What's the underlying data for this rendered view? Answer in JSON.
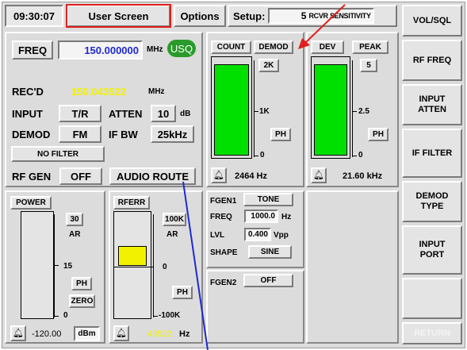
{
  "header": {
    "time": "09:30:07",
    "screen_title": "User Screen",
    "options_label": "Options",
    "setup_label": "Setup:",
    "setup_value": "5",
    "setup_item": "RCVR SENSITIVITY"
  },
  "receiver": {
    "freq_label": "FREQ",
    "freq_value": "150.000000",
    "freq_unit": "MHz",
    "usq_label": "USQ",
    "recd_label": "REC'D",
    "recd_value": "150.043522",
    "recd_unit": "MHz",
    "input_label": "INPUT",
    "input_value": "T/R",
    "atten_label": "ATTEN",
    "atten_value": "10",
    "atten_unit": "dB",
    "demod_label": "DEMOD",
    "demod_value": "FM",
    "ifbw_label": "IF BW",
    "ifbw_value": "25kHz",
    "filter_value": "NO FILTER",
    "rfgen_label": "RF GEN",
    "rfgen_value": "OFF",
    "audio_route_label": "AUDIO ROUTE"
  },
  "count_meter": {
    "count_label": "COUNT",
    "demod_label": "DEMOD",
    "range": "2K",
    "tick_mid": "1K",
    "tick_low": "0",
    "ph_label": "PH",
    "level_fraction": 0.95,
    "readout": "2464 Hz"
  },
  "dev_meter": {
    "dev_label": "DEV",
    "peak_label": "PEAK",
    "range": "5",
    "tick_mid": "2.5",
    "tick_low": "0",
    "ph_label": "PH",
    "level_fraction": 0.95,
    "readout": "21.60 kHz"
  },
  "power_meter": {
    "title": "POWER",
    "range": "30",
    "ar_label": "AR",
    "tick_mid": "15",
    "tick_low": "0",
    "ph_label": "PH",
    "zero_label": "ZERO",
    "readout_value": "-120.00",
    "readout_unit": "dBm"
  },
  "rferr_meter": {
    "title": "RFERR",
    "range": "100K",
    "ar_label": "AR",
    "tick_mid": "0",
    "tick_low": "-100K",
    "ph_label": "PH",
    "readout_value": "43522",
    "readout_unit": "Hz"
  },
  "fgen1": {
    "label": "FGEN1",
    "type": "TONE",
    "freq_label": "FREQ",
    "freq_value": "1000.0",
    "freq_unit": "Hz",
    "lvl_label": "LVL",
    "lvl_value": "0.400",
    "lvl_unit": "Vpp",
    "shape_label": "SHAPE",
    "shape_value": "SINE"
  },
  "fgen2": {
    "label": "FGEN2",
    "value": "OFF"
  },
  "softkeys": [
    {
      "label": "VOL/SQL"
    },
    {
      "label": "RF FREQ"
    },
    {
      "label": "INPUT ATTEN"
    },
    {
      "label": "IF FILTER"
    },
    {
      "label": "DEMOD TYPE"
    },
    {
      "label": "INPUT PORT"
    },
    {
      "label": ""
    },
    {
      "label": "RETURN"
    }
  ],
  "colors": {
    "highlight_red": "#e0201c",
    "usq_green": "#2a9a2a",
    "meter_green": "#00e000",
    "rferr_yellow": "#f2f200",
    "freq_blue": "#1e2ad0"
  }
}
